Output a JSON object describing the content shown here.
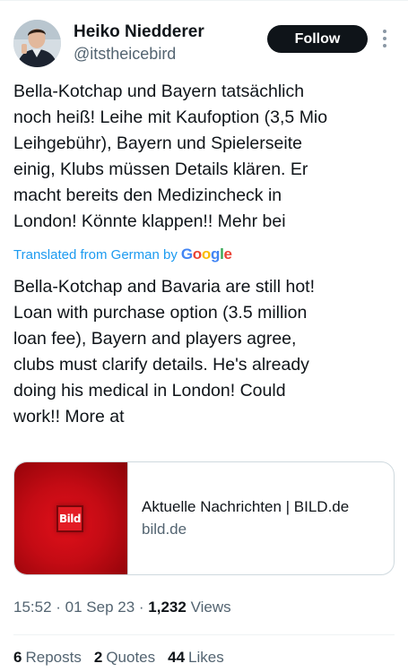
{
  "author": {
    "name": "Heiko Niedderer",
    "handle": "@itstheicebird",
    "avatar_icon": "profile-photo"
  },
  "follow_label": "Follow",
  "more_icon": "vertical-ellipsis-icon",
  "tweet": {
    "lines": [
      "Bella-Kotchap und Bayern tatsächlich",
      "noch heiß! Leihe mit Kaufoption (3,5 Mio",
      "Leihgebühr), Bayern und Spielerseite",
      "einig, Klubs müssen Details klären. Er",
      "macht bereits den Medizincheck in",
      "London! Könnte klappen!! Mehr bei"
    ]
  },
  "translation": {
    "label": "Translated from German by",
    "provider": "Google",
    "lines": [
      "Bella-Kotchap and Bavaria are still hot!",
      "Loan with purchase option (3.5 million",
      "loan fee), Bayern and players agree,",
      "clubs must clarify details. He's already",
      "doing his medical in London! Could",
      "work!! More at"
    ]
  },
  "link_card": {
    "logo_text": "Bild",
    "title": "Aktuelle Nachrichten | BILD.de",
    "domain": "bild.de"
  },
  "meta": {
    "time": "15:52",
    "date": "01 Sep 23",
    "views_count": "1,232",
    "views_label": "Views"
  },
  "stats": {
    "reposts_count": "6",
    "reposts_label": "Reposts",
    "quotes_count": "2",
    "quotes_label": "Quotes",
    "likes_count": "44",
    "likes_label": "Likes"
  },
  "colors": {
    "link_blue": "#1d9bf0",
    "follow_bg": "#0f1419",
    "secondary_text": "#536471",
    "bild_red": "#e31c24"
  }
}
